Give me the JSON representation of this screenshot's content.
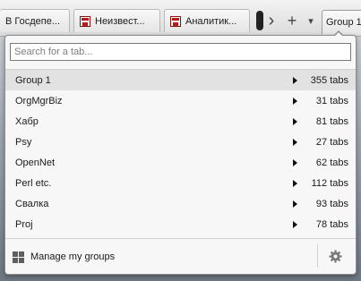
{
  "tabs": [
    {
      "label": "В Госдепе..."
    },
    {
      "label": "Неизвест..."
    },
    {
      "label": "Аналитик..."
    }
  ],
  "toolbar": {
    "scroll_right_glyph": "›",
    "new_tab_glyph": "+",
    "list_tabs_glyph": "▾",
    "group_button_label": "Group 1"
  },
  "search": {
    "placeholder": "Search for a tab...",
    "value": ""
  },
  "groups": [
    {
      "name": "Group 1",
      "count": "355 tabs",
      "selected": true
    },
    {
      "name": "OrgMgrBiz",
      "count": "31 tabs",
      "selected": false
    },
    {
      "name": "Хабр",
      "count": "81 tabs",
      "selected": false
    },
    {
      "name": "Psy",
      "count": "27 tabs",
      "selected": false
    },
    {
      "name": "OpenNet",
      "count": "62 tabs",
      "selected": false
    },
    {
      "name": "Perl etc.",
      "count": "112 tabs",
      "selected": false
    },
    {
      "name": "Свалка",
      "count": "93 tabs",
      "selected": false
    },
    {
      "name": "Proj",
      "count": "78 tabs",
      "selected": false
    }
  ],
  "footer": {
    "manage_label": "Manage my groups",
    "manage_icon": "grid-icon",
    "settings_icon": "gear-icon"
  },
  "colors": {
    "selected_row": "#e2e2e2",
    "panel_background": "#f7f7f7",
    "favicon_red": "#b51c1c"
  }
}
